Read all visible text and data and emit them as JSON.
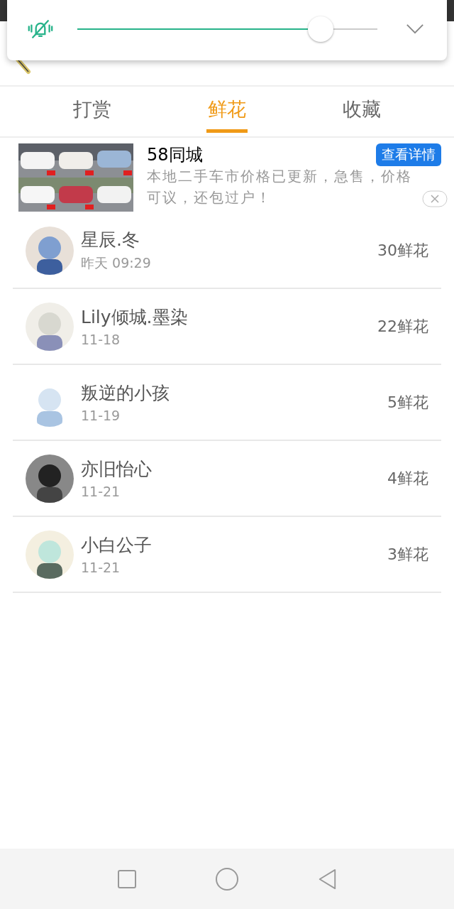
{
  "volume_panel": {
    "muted": true,
    "level": 0.81
  },
  "tabs": [
    {
      "label": "打赏",
      "selected": false
    },
    {
      "label": "鲜花",
      "selected": true
    },
    {
      "label": "收藏",
      "selected": false
    }
  ],
  "ad": {
    "title": "58同城",
    "button": "查看详情",
    "text": "本地二手车市价格已更新，急售，价格可议，还包过户！"
  },
  "fans": [
    {
      "name": "星辰.冬",
      "date": "昨天 09:29",
      "count": "30鲜花"
    },
    {
      "name": "Lily倾城.墨染",
      "date": "11-18",
      "count": "22鲜花"
    },
    {
      "name": "叛逆的小孩",
      "date": "11-19",
      "count": "5鲜花"
    },
    {
      "name": "亦旧怡心",
      "date": "11-21",
      "count": "4鲜花"
    },
    {
      "name": "小白公子",
      "date": "11-21",
      "count": "3鲜花"
    }
  ]
}
